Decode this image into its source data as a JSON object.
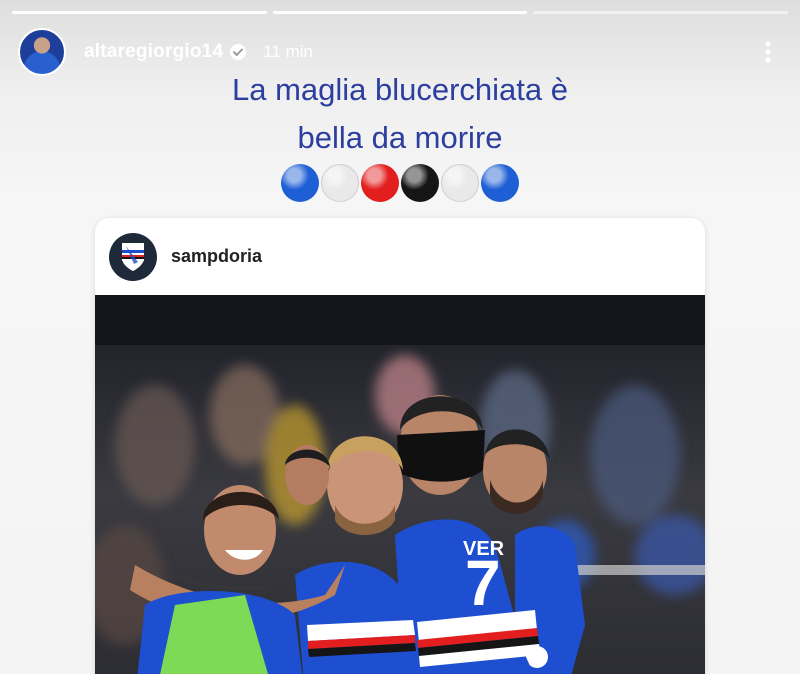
{
  "story": {
    "progress_segments": [
      1,
      1,
      0
    ],
    "username": "altaregiorgio14",
    "time_ago": "11 min",
    "icons": {
      "verified": "verified-badge-icon",
      "more": "more-vertical-icon"
    }
  },
  "caption": {
    "line1": "La maglia blucerchiata è",
    "line2": "bella da morire",
    "emoji_circles": [
      "#1f5fd6",
      "#e9e9e9",
      "#e21e1e",
      "#151515",
      "#e9e9e9",
      "#1f5fd6"
    ]
  },
  "shared_post": {
    "account": "sampdoria",
    "photo_jersey_number": "7"
  },
  "colors": {
    "caption_text": "#2c3e9e",
    "jersey_blue": "#1e4fd0"
  }
}
